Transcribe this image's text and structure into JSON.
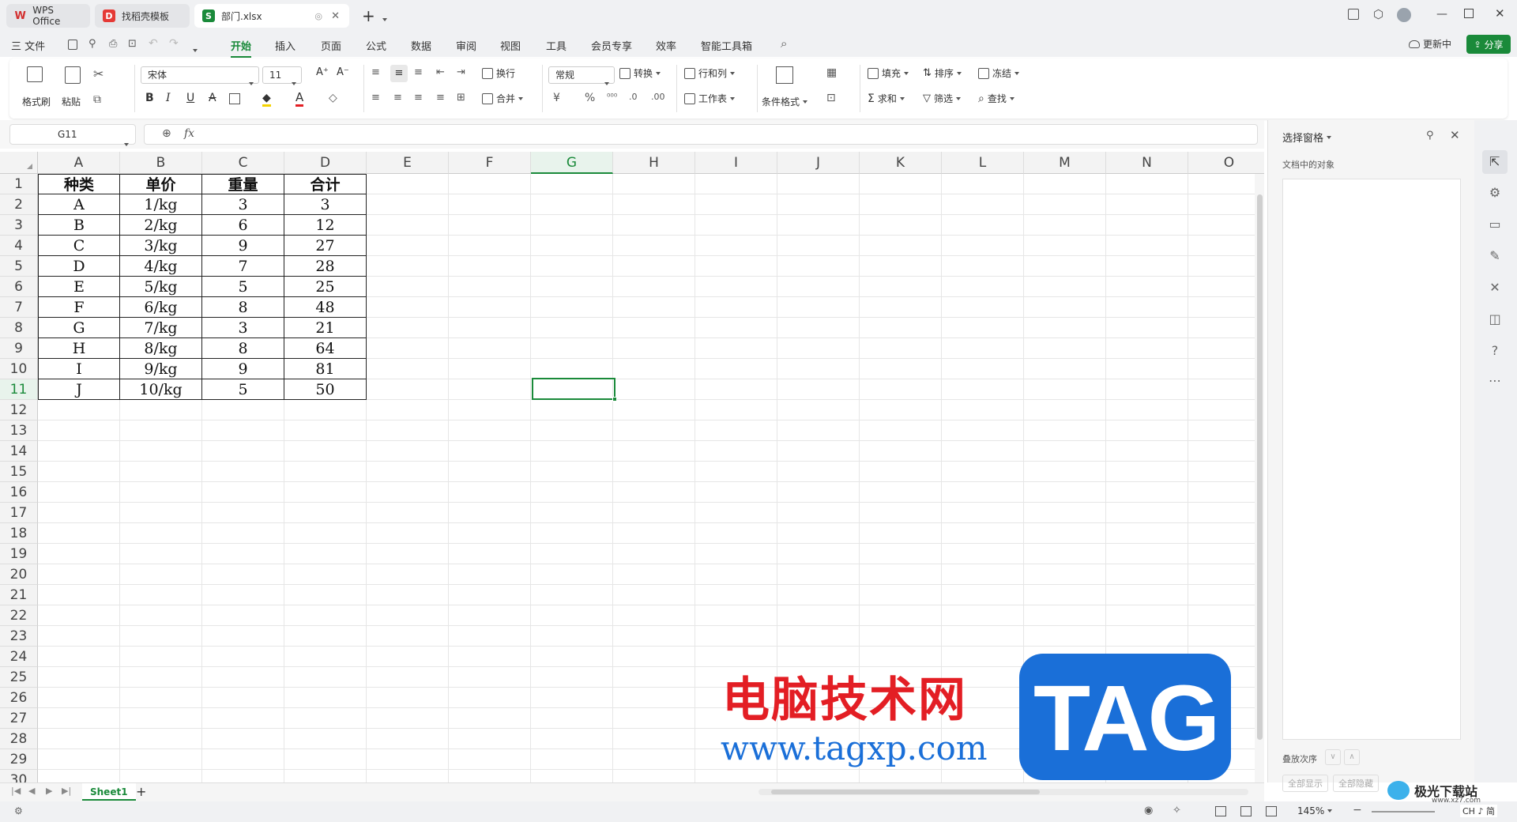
{
  "tabs": [
    {
      "label": "WPS Office",
      "icon": "wps-logo-icon"
    },
    {
      "label": "找稻壳模板",
      "icon": "docer-icon"
    },
    {
      "label": "部门.xlsx",
      "icon": "spreadsheet-icon"
    }
  ],
  "menu": {
    "file": "三 文件",
    "items": [
      "开始",
      "插入",
      "页面",
      "公式",
      "数据",
      "审阅",
      "视图",
      "工具",
      "会员专享",
      "效率",
      "智能工具箱"
    ],
    "active": "开始",
    "update": "更新中",
    "share": "分享"
  },
  "ribbon": {
    "format_painter": "格式刷",
    "paste": "粘贴",
    "font_name": "宋体",
    "font_size": "11",
    "bold": "B",
    "italic": "I",
    "underline": "U",
    "wrap": "换行",
    "merge": "合并",
    "number_format": "常规",
    "convert": "转换",
    "rows_cols": "行和列",
    "worksheet": "工作表",
    "cond_format": "条件格式",
    "fill": "填充",
    "sort": "排序",
    "freeze": "冻结",
    "sum": "求和",
    "filter": "筛选",
    "find": "查找"
  },
  "formula_bar": {
    "name_box": "G11",
    "fx": "fx",
    "value": ""
  },
  "columns": [
    "A",
    "B",
    "C",
    "D",
    "E",
    "F",
    "G",
    "H",
    "I",
    "J",
    "K",
    "L",
    "M",
    "N",
    "O"
  ],
  "rows": [
    "1",
    "2",
    "3",
    "4",
    "5",
    "6",
    "7",
    "8",
    "9",
    "10",
    "11",
    "12",
    "13",
    "14",
    "15",
    "16",
    "17",
    "18",
    "19",
    "20",
    "21",
    "22",
    "23",
    "24",
    "25",
    "26",
    "27",
    "28",
    "29",
    "30"
  ],
  "table": {
    "headers": [
      "种类",
      "单价",
      "重量",
      "合计"
    ],
    "rows": [
      [
        "A",
        "1/kg",
        "3",
        "3"
      ],
      [
        "B",
        "2/kg",
        "6",
        "12"
      ],
      [
        "C",
        "3/kg",
        "9",
        "27"
      ],
      [
        "D",
        "4/kg",
        "7",
        "28"
      ],
      [
        "E",
        "5/kg",
        "5",
        "25"
      ],
      [
        "F",
        "6/kg",
        "8",
        "48"
      ],
      [
        "G",
        "7/kg",
        "3",
        "21"
      ],
      [
        "H",
        "8/kg",
        "8",
        "64"
      ],
      [
        "I",
        "9/kg",
        "9",
        "81"
      ],
      [
        "J",
        "10/kg",
        "5",
        "50"
      ]
    ]
  },
  "selected_cell": "G11",
  "selection_pane": {
    "title": "选择窗格",
    "objects_label": "文档中的对象",
    "order_label": "叠放次序",
    "show_all": "全部显示",
    "hide_all": "全部隐藏"
  },
  "sheet": {
    "name": "Sheet1",
    "add": "+"
  },
  "status": {
    "zoom": "145%",
    "input_mode": "CH ♪ 简"
  },
  "watermark": {
    "text_cn": "电脑技术网",
    "url": "www.tagxp.com",
    "logo": "TAG",
    "site": "极光下载站",
    "site_url": "www.xz7.com"
  },
  "colors": {
    "accent": "#1a8a3a",
    "watermark_red": "#e31e24",
    "watermark_blue": "#1a6fd8"
  }
}
